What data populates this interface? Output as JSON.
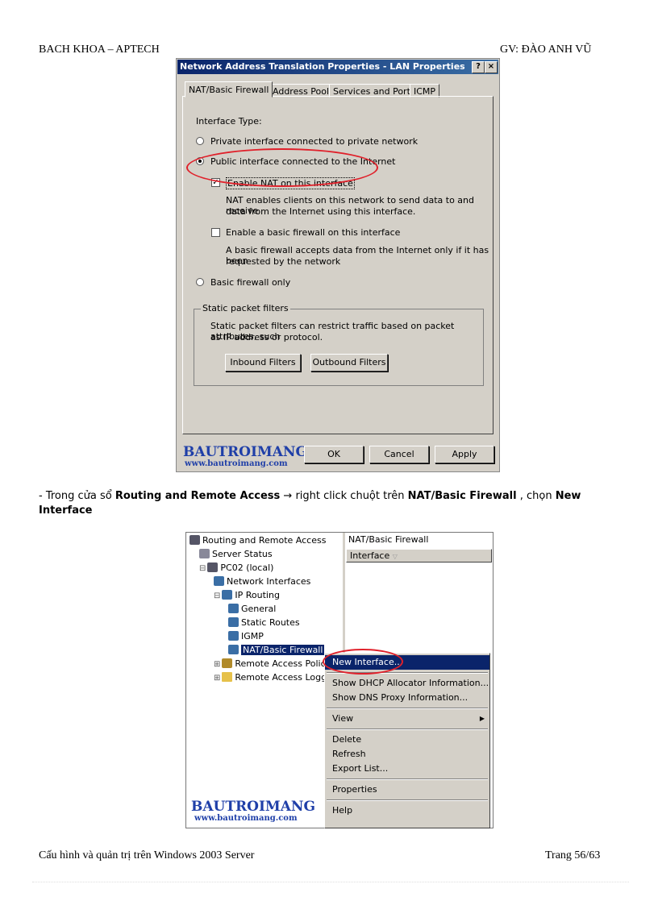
{
  "header": {
    "left": "BACH KHOA – APTECH",
    "right": "GV:  ĐÀO ANH VŨ"
  },
  "dialog": {
    "title": "Network Address Translation Properties - LAN Properties",
    "help": "?",
    "close": "×",
    "tabs": [
      "NAT/Basic Firewall",
      "Address Pool",
      "Services and Ports",
      "ICMP"
    ],
    "interface_type_label": "Interface Type:",
    "radio_private": "Private interface connected to private network",
    "radio_public": "Public interface connected to the Internet",
    "chk_enable_nat": "Enable NAT on this interface",
    "nat_desc_1": "NAT enables clients on this network to send data to and receive",
    "nat_desc_2": "data from the Internet using this interface.",
    "chk_basic_fw": "Enable a basic firewall on this interface",
    "fw_desc_1": "A basic firewall accepts data from the Internet only if it has been",
    "fw_desc_2": "requested by the network",
    "radio_basic_fw": "Basic firewall only",
    "static_group": "Static packet filters",
    "static_desc_1": "Static packet filters can restrict traffic based on packet attributes, such",
    "static_desc_2": "as IP address or protocol.",
    "btn_inbound": "Inbound Filters",
    "btn_outbound": "Outbound Filters",
    "btn_ok": "OK",
    "btn_cancel": "Cancel",
    "btn_apply": "Apply"
  },
  "logo": {
    "name": "BAUTROIMANG",
    "url": "www.bautroimang.com"
  },
  "instruction": {
    "prefix": "- Trong cửa sổ ",
    "b1": "Routing  and Remote Access",
    "mid": " → right  click chuột trên ",
    "b2": "NAT/Basic Firewall",
    "mid2": " , chọn ",
    "b3": "New",
    "b4": "Interface"
  },
  "tree": {
    "items": [
      {
        "label": "Routing and Remote Access",
        "icon": "server-computer-icon"
      },
      {
        "label": "Server Status",
        "icon": "server-stack-icon"
      },
      {
        "label": "PC02 (local)",
        "icon": "server-computer-icon"
      },
      {
        "label": "Network Interfaces",
        "icon": "network-icon"
      },
      {
        "label": "IP Routing",
        "icon": "network-icon"
      },
      {
        "label": "General",
        "icon": "network-icon"
      },
      {
        "label": "Static Routes",
        "icon": "network-icon"
      },
      {
        "label": "IGMP",
        "icon": "network-icon"
      },
      {
        "label": "NAT/Basic Firewall",
        "icon": "network-icon"
      },
      {
        "label": "Remote Access Polici",
        "icon": "policy-icon"
      },
      {
        "label": "Remote Access Logg",
        "icon": "folder-icon"
      }
    ],
    "right_title": "NAT/Basic Firewall",
    "right_col": "Interface"
  },
  "menu": {
    "items": [
      "New Interface...",
      "Show DHCP Allocator Information...",
      "Show DNS Proxy Information...",
      "View",
      "Delete",
      "Refresh",
      "Export List...",
      "Properties",
      "Help"
    ]
  },
  "footer": {
    "left": "Cấu hình và quản trị trên Windows 2003 Server",
    "right": "Trang  56/63"
  }
}
